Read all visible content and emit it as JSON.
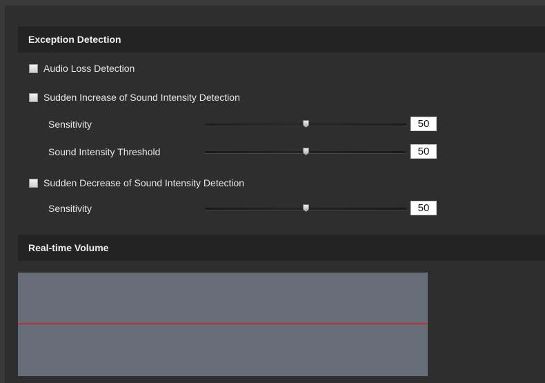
{
  "exception_detection": {
    "title": "Exception Detection",
    "audio_loss": {
      "label": "Audio Loss Detection",
      "checked": false
    },
    "sudden_increase": {
      "label": "Sudden Increase of Sound Intensity Detection",
      "checked": false,
      "sensitivity": {
        "label": "Sensitivity",
        "value": "50"
      },
      "threshold": {
        "label": "Sound Intensity Threshold",
        "value": "50"
      }
    },
    "sudden_decrease": {
      "label": "Sudden Decrease of Sound Intensity Detection",
      "checked": false,
      "sensitivity": {
        "label": "Sensitivity",
        "value": "50"
      }
    }
  },
  "realtime_volume": {
    "title": "Real-time Volume",
    "current_level_percent": 50
  },
  "colors": {
    "header_bg": "#232323",
    "panel_bg": "#2e2e2e",
    "volume_bg": "#666c78",
    "level_line": "#c0302c"
  }
}
